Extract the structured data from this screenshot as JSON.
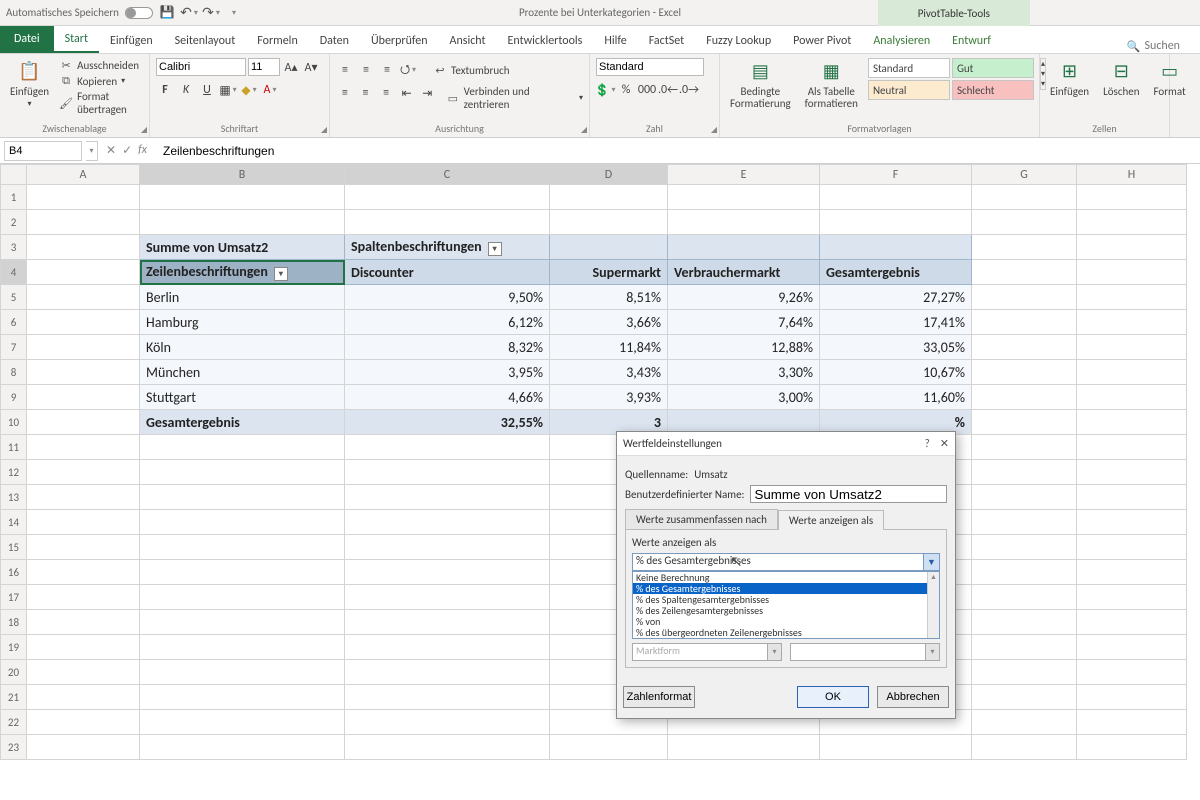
{
  "titlebar": {
    "autosave": "Automatisches Speichern",
    "doc_title": "Prozente bei Unterkategorien - Excel",
    "pivot_tools": "PivotTable-Tools"
  },
  "tabs": {
    "file": "Datei",
    "items": [
      "Start",
      "Einfügen",
      "Seitenlayout",
      "Formeln",
      "Daten",
      "Überprüfen",
      "Ansicht",
      "Entwicklertools",
      "Hilfe",
      "FactSet",
      "Fuzzy Lookup",
      "Power Pivot"
    ],
    "ctx": [
      "Analysieren",
      "Entwurf"
    ],
    "search": "Suchen"
  },
  "ribbon": {
    "clipboard": {
      "paste": "Einfügen",
      "cut": "Ausschneiden",
      "copy": "Kopieren",
      "fmt": "Format übertragen",
      "label": "Zwischenablage"
    },
    "font": {
      "name": "Calibri",
      "size": "11",
      "label": "Schriftart"
    },
    "align": {
      "wrap": "Textumbruch",
      "merge": "Verbinden und zentrieren",
      "label": "Ausrichtung"
    },
    "number": {
      "format": "Standard",
      "label": "Zahl"
    },
    "styles": {
      "cond": "Bedingte Formatierung",
      "astable": "Als Tabelle formatieren",
      "s_standard": "Standard",
      "s_gut": "Gut",
      "s_neutral": "Neutral",
      "s_schlecht": "Schlecht",
      "label": "Formatvorlagen"
    },
    "cells": {
      "insert": "Einfügen",
      "delete": "Löschen",
      "format": "Format",
      "label": "Zellen"
    }
  },
  "fx": {
    "cell": "B4",
    "value": "Zeilenbeschriftungen"
  },
  "cols": [
    "A",
    "B",
    "C",
    "D",
    "E",
    "F",
    "G",
    "H"
  ],
  "pivot": {
    "val_label": "Summe von Umsatz2",
    "col_label": "Spaltenbeschriftungen",
    "row_label": "Zeilenbeschriftungen",
    "cols": [
      "Discounter",
      "Supermarkt",
      "Verbrauchermarkt",
      "Gesamtergebnis"
    ],
    "rows": [
      {
        "name": "Berlin",
        "v": [
          "9,50%",
          "8,51%",
          "9,26%",
          "27,27%"
        ]
      },
      {
        "name": "Hamburg",
        "v": [
          "6,12%",
          "3,66%",
          "7,64%",
          "17,41%"
        ]
      },
      {
        "name": "Köln",
        "v": [
          "8,32%",
          "11,84%",
          "12,88%",
          "33,05%"
        ]
      },
      {
        "name": "München",
        "v": [
          "3,95%",
          "3,43%",
          "3,30%",
          "10,67%"
        ]
      },
      {
        "name": "Stuttgart",
        "v": [
          "4,66%",
          "3,93%",
          "3,00%",
          "11,60%"
        ]
      }
    ],
    "total_label": "Gesamtergebnis",
    "totals": [
      "32,55%",
      "3",
      "",
      "%"
    ]
  },
  "dialog": {
    "title": "Wertfeldeinstellungen",
    "src_label": "Quellenname:",
    "src_value": "Umsatz",
    "name_label": "Benutzerdefinierter Name:",
    "name_value": "Summe von Umsatz2",
    "tab_summ": "Werte zusammenfassen nach",
    "tab_show": "Werte anzeigen als",
    "show_as_label": "Werte anzeigen als",
    "combo_value": "% des Gesamtergebnisses",
    "options": [
      "Keine Berechnung",
      "% des Gesamtergebnisses",
      "% des Spaltengesamtergebnisses",
      "% des Zeilengesamtergebnisses",
      "% von",
      "% des übergeordneten Zeilenergebnisses"
    ],
    "base_item": "Marktform",
    "btn_numfmt": "Zahlenformat",
    "btn_ok": "OK",
    "btn_cancel": "Abbrechen"
  }
}
